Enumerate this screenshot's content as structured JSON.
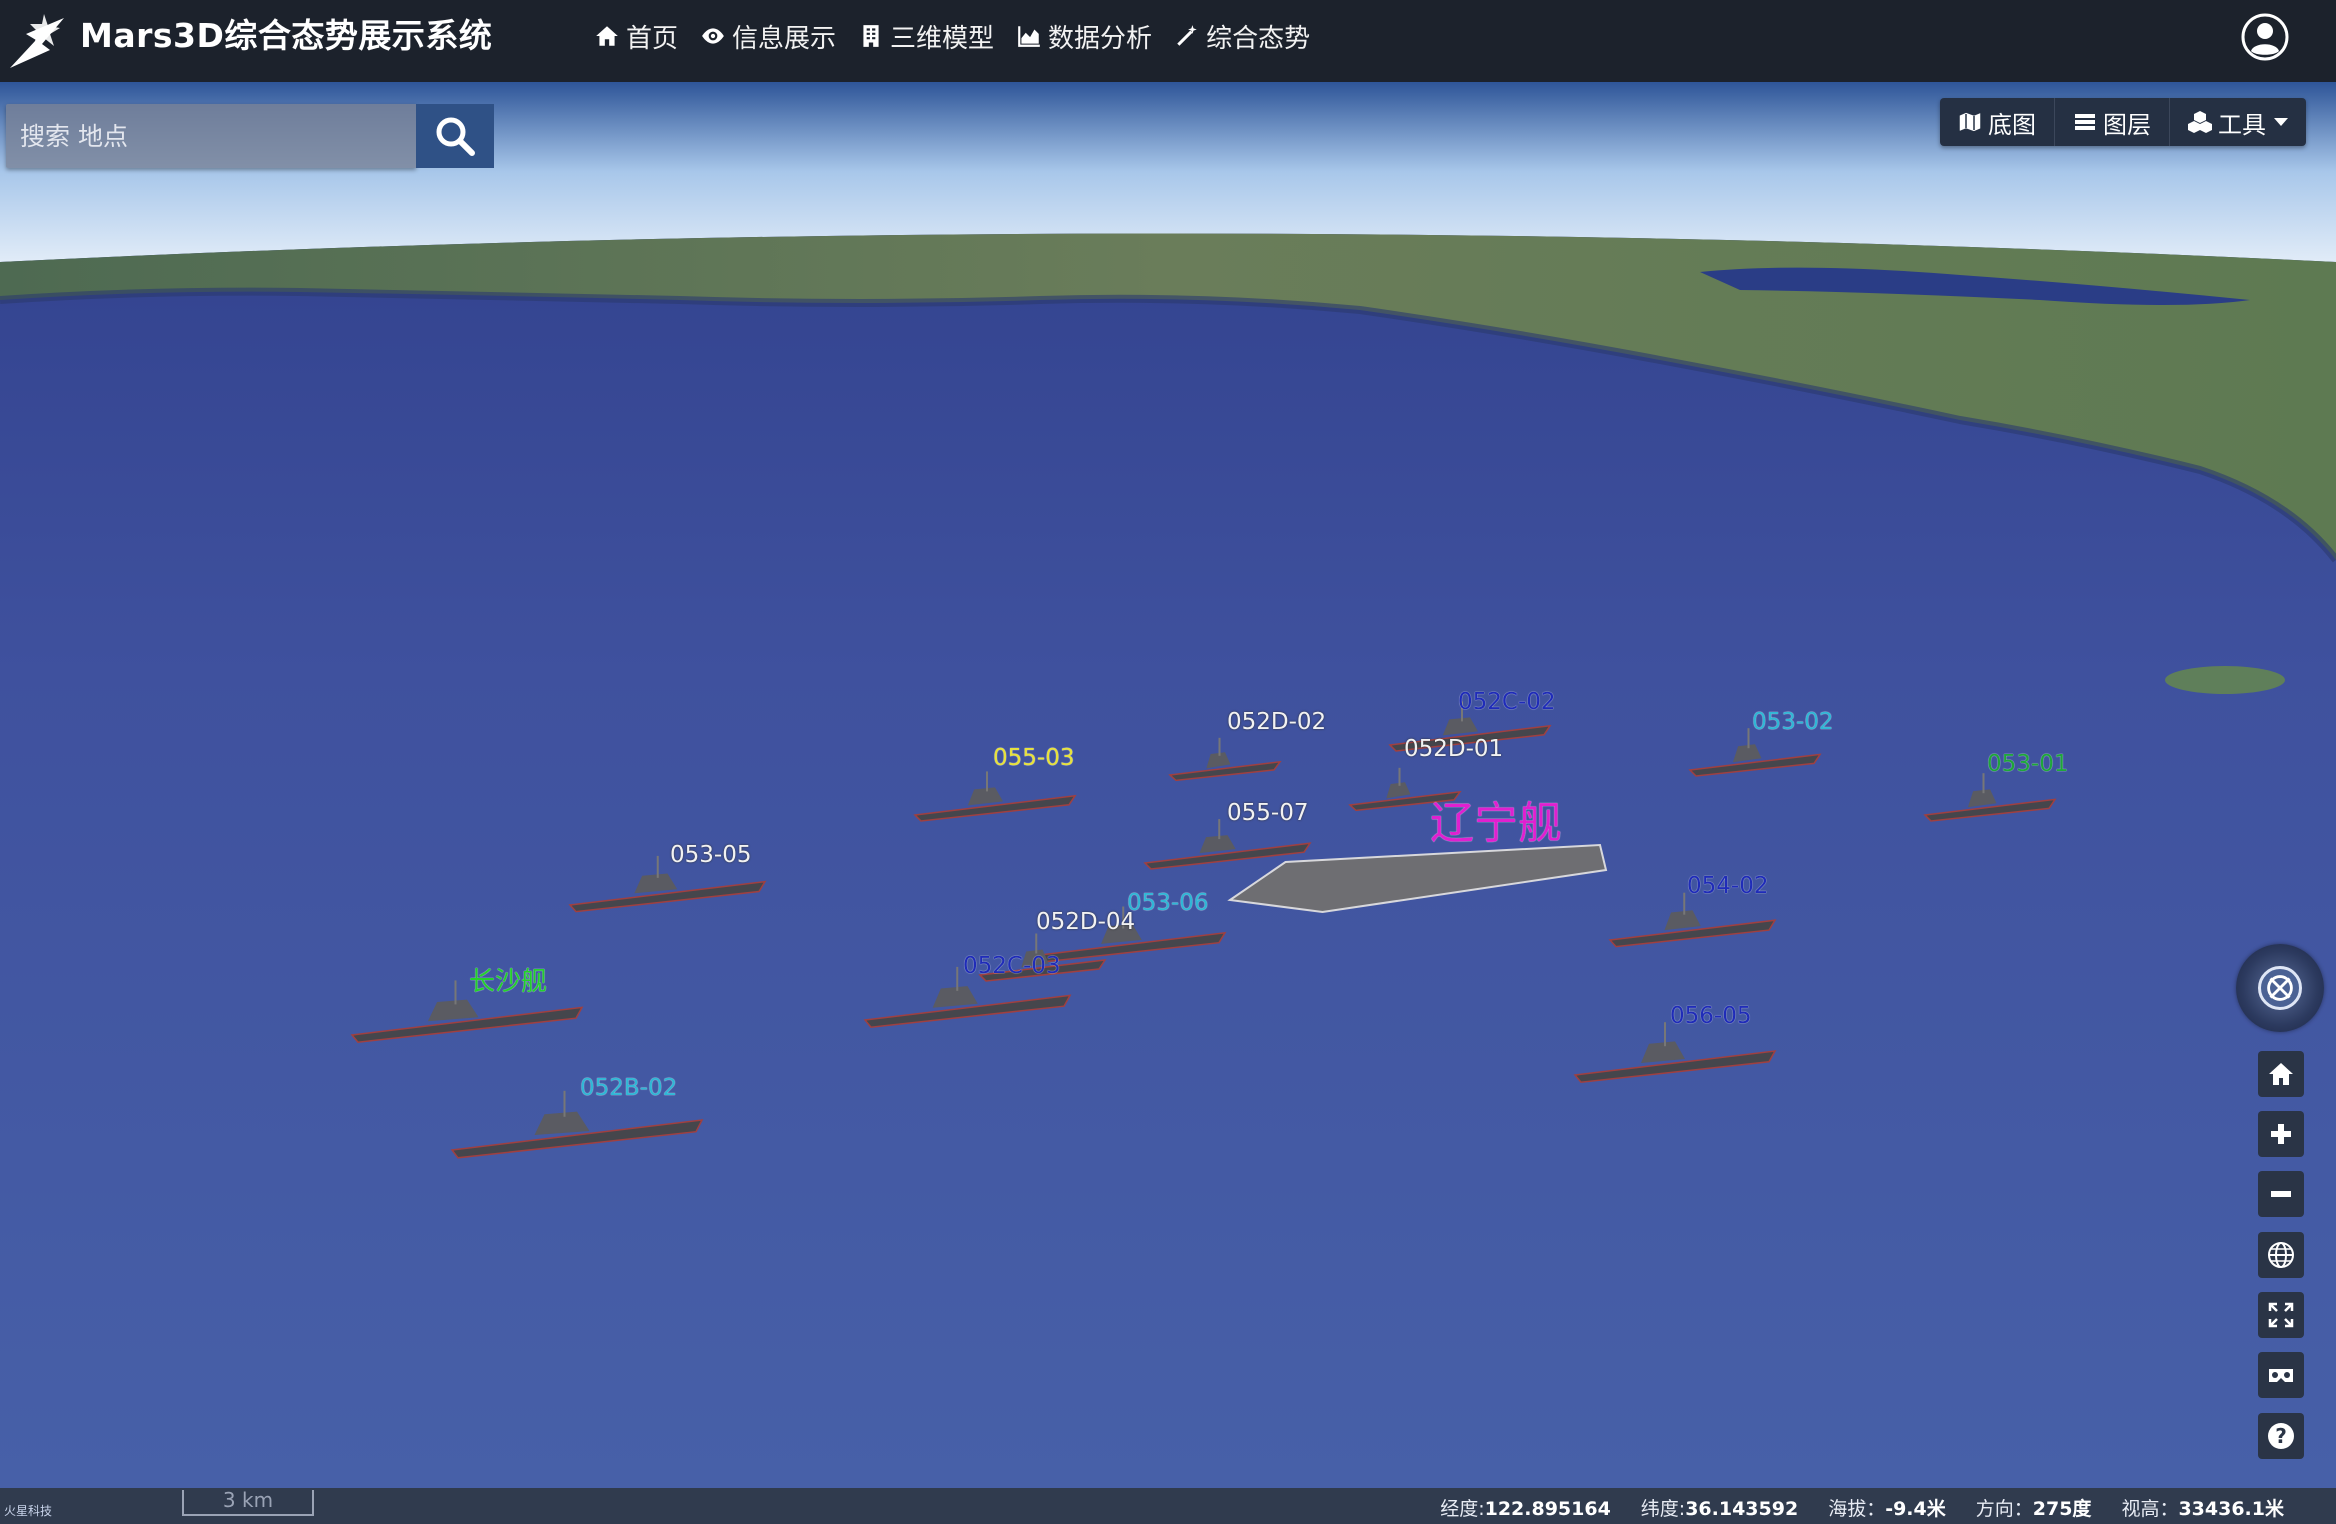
{
  "app": {
    "title": "Mars3D综合态势展示系统",
    "nav": [
      {
        "icon": "home-icon",
        "label": "首页"
      },
      {
        "icon": "eye-icon",
        "label": "信息展示"
      },
      {
        "icon": "building-icon",
        "label": "三维模型"
      },
      {
        "icon": "area-chart-icon",
        "label": "数据分析"
      },
      {
        "icon": "magic-wand-icon",
        "label": "综合态势"
      }
    ]
  },
  "search": {
    "placeholder": "搜索 地点"
  },
  "toolbar": {
    "basemap_label": "底图",
    "layers_label": "图层",
    "tools_label": "工具"
  },
  "ships": [
    {
      "label": "052C-02",
      "color": "#1f2cb8"
    },
    {
      "label": "052D-02",
      "color": "#f2f2f2"
    },
    {
      "label": "052D-01",
      "color": "#f2f2f2"
    },
    {
      "label": "053-02",
      "color": "#2fb7d6"
    },
    {
      "label": "055-03",
      "color": "#e8e23a"
    },
    {
      "label": "053-01",
      "color": "#1ea63a"
    },
    {
      "label": "055-07",
      "color": "#f2f2f2"
    },
    {
      "label": "辽宁舰",
      "color": "#e020d0"
    },
    {
      "label": "053-05",
      "color": "#f2f2f2"
    },
    {
      "label": "053-06",
      "color": "#2fb7d6"
    },
    {
      "label": "052D-04",
      "color": "#f2f2f2"
    },
    {
      "label": "054-02",
      "color": "#1f2cb8"
    },
    {
      "label": "052C-03",
      "color": "#1f2cb8"
    },
    {
      "label": "长沙舰",
      "color": "#23d02c"
    },
    {
      "label": "056-05",
      "color": "#1f2cb8"
    },
    {
      "label": "052B-02",
      "color": "#2fb7d6"
    }
  ],
  "status": {
    "brand": "火星科技",
    "scale": "3 km",
    "lon_label": "经度:",
    "lon": "122.895164",
    "lat_label": "纬度:",
    "lat": "36.143592",
    "alt_label": "海拔：",
    "alt": "-9.4米",
    "heading_label": "方向：",
    "heading": "275度",
    "height_label": "视高：",
    "height": "33436.1米"
  }
}
